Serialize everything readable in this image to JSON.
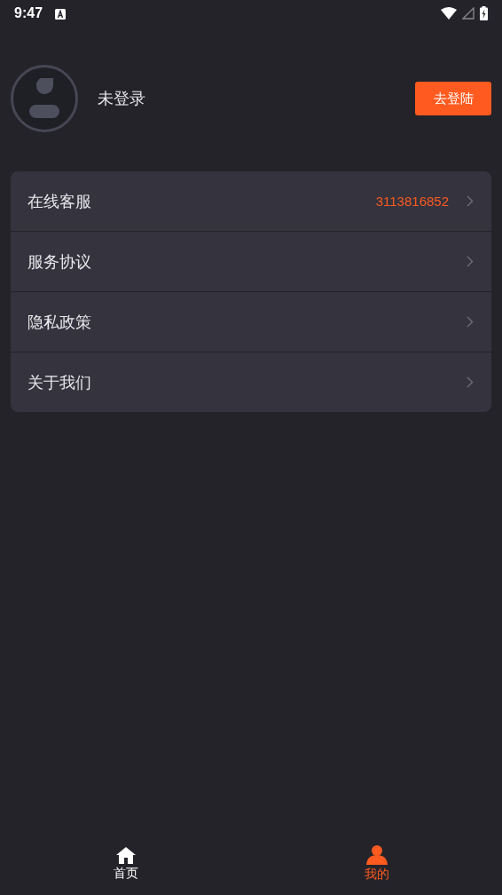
{
  "status_bar": {
    "time": "9:47"
  },
  "profile": {
    "name": "未登录",
    "login_button": "去登陆"
  },
  "menu": [
    {
      "label": "在线客服",
      "value": "3113816852"
    },
    {
      "label": "服务协议"
    },
    {
      "label": "隐私政策"
    },
    {
      "label": "关于我们"
    }
  ],
  "tab_bar": [
    {
      "label": "首页",
      "kind": "home",
      "selected": false
    },
    {
      "label": "我的",
      "kind": "profile",
      "selected": true
    }
  ]
}
